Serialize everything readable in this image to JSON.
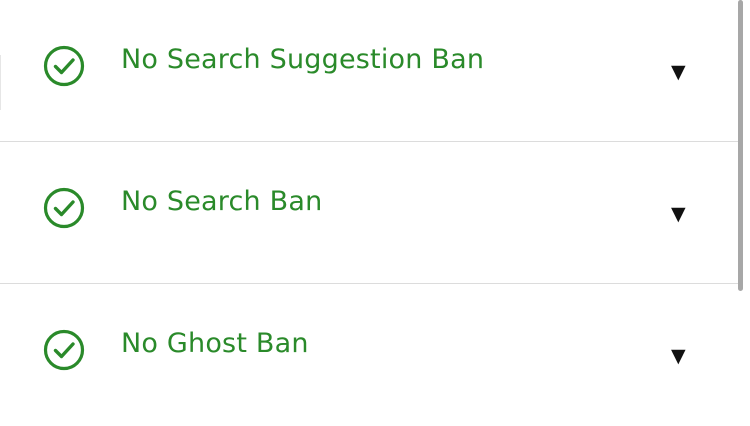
{
  "theme": {
    "success_color": "#2a8a2a",
    "caret_color": "#111111",
    "divider_color": "#dcdcdc"
  },
  "checks": [
    {
      "label": "No Search Suggestion Ban",
      "status_icon": "check-circle-icon",
      "expand_icon": "▼",
      "expanded": false
    },
    {
      "label": "No Search Ban",
      "status_icon": "check-circle-icon",
      "expand_icon": "▼",
      "expanded": false
    },
    {
      "label": "No Ghost Ban",
      "status_icon": "check-circle-icon",
      "expand_icon": "▼",
      "expanded": false
    }
  ]
}
